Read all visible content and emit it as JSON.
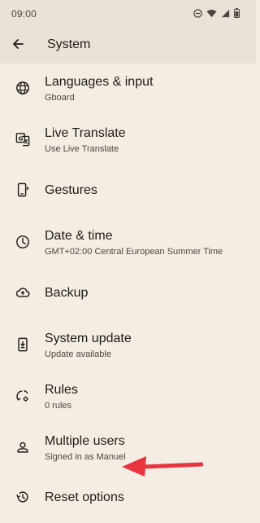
{
  "status_bar": {
    "time": "09:00",
    "icons": [
      "do-not-disturb-icon",
      "wifi-icon",
      "signal-icon",
      "battery-icon"
    ]
  },
  "app_bar": {
    "title": "System",
    "back_icon": "arrow-back-icon"
  },
  "items": [
    {
      "icon": "globe-icon",
      "title": "Languages & input",
      "subtitle": "Gboard"
    },
    {
      "icon": "translate-icon",
      "title": "Live Translate",
      "subtitle": "Use Live Translate"
    },
    {
      "icon": "phone-gesture-icon",
      "title": "Gestures",
      "subtitle": ""
    },
    {
      "icon": "clock-icon",
      "title": "Date & time",
      "subtitle": "GMT+02:00 Central European Summer Time"
    },
    {
      "icon": "cloud-upload-icon",
      "title": "Backup",
      "subtitle": ""
    },
    {
      "icon": "system-update-icon",
      "title": "System update",
      "subtitle": "Update available"
    },
    {
      "icon": "rules-icon",
      "title": "Rules",
      "subtitle": "0 rules"
    },
    {
      "icon": "person-icon",
      "title": "Multiple users",
      "subtitle": "Signed in as Manuel"
    },
    {
      "icon": "history-icon",
      "title": "Reset options",
      "subtitle": ""
    }
  ],
  "annotation": {
    "arrow_color": "#e8343f",
    "points_to": "Reset options"
  },
  "colors": {
    "background": "#f4ede4",
    "app_bar": "#eae2d8",
    "text_primary": "#1f1b16",
    "text_secondary": "#4d4640"
  }
}
